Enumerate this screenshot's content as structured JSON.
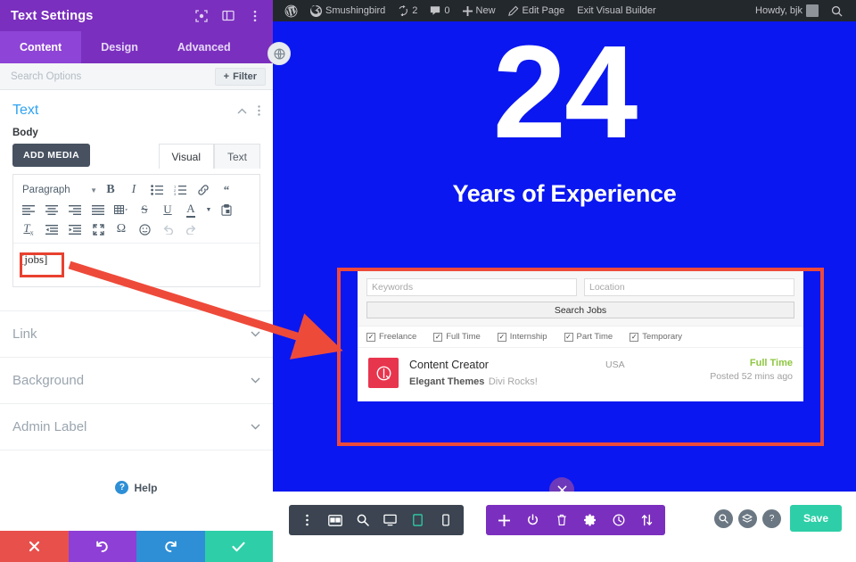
{
  "sidebar": {
    "title": "Text Settings",
    "header_icons": [
      "focus-icon",
      "split-layout-icon",
      "kebab-menu-icon"
    ],
    "tabs": [
      {
        "label": "Content",
        "active": true
      },
      {
        "label": "Design",
        "active": false
      },
      {
        "label": "Advanced",
        "active": false
      }
    ],
    "search": {
      "placeholder": "Search Options",
      "filter_label": "Filter"
    },
    "section": {
      "title": "Text"
    },
    "field": {
      "label": "Body"
    },
    "editor": {
      "add_media_label": "ADD MEDIA",
      "tabs": [
        {
          "label": "Visual",
          "active": true
        },
        {
          "label": "Text",
          "active": false
        }
      ],
      "format_select": "Paragraph",
      "toolbar_row1": [
        "bold-icon",
        "italic-icon",
        "bullet-list-icon",
        "numbered-list-icon",
        "link-icon",
        "blockquote-icon"
      ],
      "toolbar_row2": [
        "align-left-icon",
        "align-center-icon",
        "align-right-icon",
        "align-justify-icon",
        "table-icon",
        "strikethrough-icon",
        "underline-icon",
        "text-color-icon",
        "paste-icon"
      ],
      "toolbar_row3": [
        "clear-formatting-icon",
        "outdent-icon",
        "indent-icon",
        "fullscreen-icon",
        "special-character-icon",
        "emoji-icon",
        "undo-icon",
        "redo-icon"
      ],
      "content": "[jobs]"
    },
    "accordions": [
      {
        "label": "Link"
      },
      {
        "label": "Background"
      },
      {
        "label": "Admin Label"
      }
    ],
    "help_label": "Help",
    "footer_buttons": [
      {
        "name": "cancel",
        "icon": "close-icon",
        "color": "#e8504c"
      },
      {
        "name": "undo",
        "icon": "undo-icon",
        "color": "#8e3fd6"
      },
      {
        "name": "redo",
        "icon": "redo-icon",
        "color": "#2e8fd6"
      },
      {
        "name": "save",
        "icon": "check-icon",
        "color": "#2ecfa8"
      }
    ]
  },
  "adminbar": {
    "site_name": "Smushingbird",
    "updates_count": "2",
    "comments_count": "0",
    "new_label": "New",
    "edit_page_label": "Edit Page",
    "exit_builder_label": "Exit Visual Builder",
    "howdy_label": "Howdy, bjk"
  },
  "hero": {
    "number": "24",
    "subtitle": "Years of Experience",
    "background_color": "#0a17f0"
  },
  "job_widget": {
    "keywords_placeholder": "Keywords",
    "location_placeholder": "Location",
    "search_button_label": "Search Jobs",
    "filters": [
      {
        "label": "Freelance",
        "checked": true
      },
      {
        "label": "Full Time",
        "checked": true
      },
      {
        "label": "Internship",
        "checked": true
      },
      {
        "label": "Part Time",
        "checked": true
      },
      {
        "label": "Temporary",
        "checked": true
      }
    ],
    "listings": [
      {
        "title": "Content Creator",
        "company": "Elegant Themes",
        "tagline": "Divi Rocks!",
        "location": "USA",
        "type": "Full Time",
        "type_color": "#8dc63f",
        "posted": "Posted 52 mins ago",
        "logo_color": "#e8354e"
      }
    ]
  },
  "bottom_bar": {
    "dark_icons": [
      "kebab-menu-icon",
      "wireframe-icon",
      "zoom-icon",
      "desktop-icon",
      "tablet-icon",
      "phone-icon"
    ],
    "purple_icons": [
      "add-icon",
      "power-icon",
      "trash-icon",
      "gear-icon",
      "history-icon",
      "sort-icon"
    ],
    "right_circles": [
      "search-icon",
      "layers-icon",
      "help-icon"
    ],
    "save_label": "Save"
  },
  "annotation": {
    "accent_color": "#ee4a3a",
    "targets": [
      "shortcode-highlight",
      "job-widget-highlight",
      "pointer-arrow"
    ]
  }
}
